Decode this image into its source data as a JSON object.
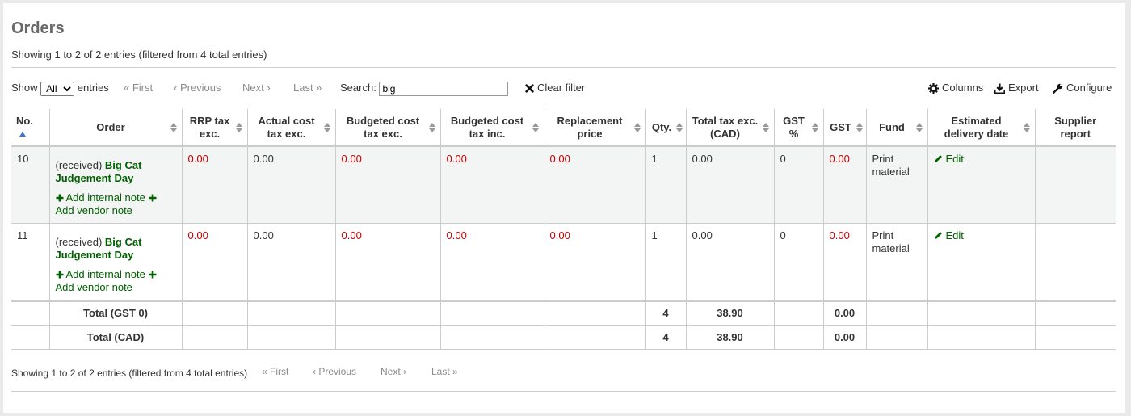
{
  "page": {
    "title": "Orders",
    "info_top": "Showing 1 to 2 of 2 entries (filtered from 4 total entries)",
    "info_bottom": "Showing 1 to 2 of 2 entries (filtered from 4 total entries)"
  },
  "toolbar": {
    "show_label": "Show",
    "show_value": "All",
    "entries_label": "entries",
    "first": "« First",
    "previous": "‹ Previous",
    "next": "Next ›",
    "last": "Last »",
    "search_label": "Search:",
    "search_value": "big",
    "clear_filter": "Clear filter",
    "columns": "Columns",
    "export": "Export",
    "configure": "Configure"
  },
  "table": {
    "headers": {
      "no": "No.",
      "order": "Order",
      "rrp": "RRP tax exc.",
      "actual": "Actual cost tax exc.",
      "bud_exc": "Budgeted cost tax exc.",
      "bud_inc": "Budgeted cost tax inc.",
      "replacement": "Replacement price",
      "qty": "Qty.",
      "total_exc": "Total tax exc. (CAD)",
      "gst_pct": "GST %",
      "gst": "GST",
      "fund": "Fund",
      "delivery": "Estimated delivery date",
      "supplier": "Supplier report"
    },
    "rows": [
      {
        "no": "10",
        "status": "(received)",
        "title": "Big Cat Judgement Day",
        "internal_note": "Add internal note",
        "vendor_note": "Add vendor note",
        "rrp": "0.00",
        "actual": "0.00",
        "bud_exc": "0.00",
        "bud_inc": "0.00",
        "replacement": "0.00",
        "qty": "1",
        "total_exc": "0.00",
        "gst_pct": "0",
        "gst": "0.00",
        "fund": "Print material",
        "edit": "Edit"
      },
      {
        "no": "11",
        "status": "(received)",
        "title": "Big Cat Judgement Day",
        "internal_note": "Add internal note",
        "vendor_note": "Add vendor note",
        "rrp": "0.00",
        "actual": "0.00",
        "bud_exc": "0.00",
        "bud_inc": "0.00",
        "replacement": "0.00",
        "qty": "1",
        "total_exc": "0.00",
        "gst_pct": "0",
        "gst": "0.00",
        "fund": "Print material",
        "edit": "Edit"
      }
    ],
    "footer": [
      {
        "label": "Total (GST 0)",
        "qty": "4",
        "total": "38.90",
        "gst": "0.00"
      },
      {
        "label": "Total (CAD)",
        "qty": "4",
        "total": "38.90",
        "gst": "0.00"
      }
    ]
  },
  "colors": {
    "link_green": "#006100",
    "negative_red": "#cc0000",
    "row_alt_bg": "#f3f4f4",
    "title_gray": "#696969"
  },
  "icons": [
    "close-icon",
    "gear-icon",
    "download-icon",
    "wrench-icon",
    "plus-icon",
    "pencil-icon",
    "sort-asc-icon",
    "sort-icon"
  ]
}
